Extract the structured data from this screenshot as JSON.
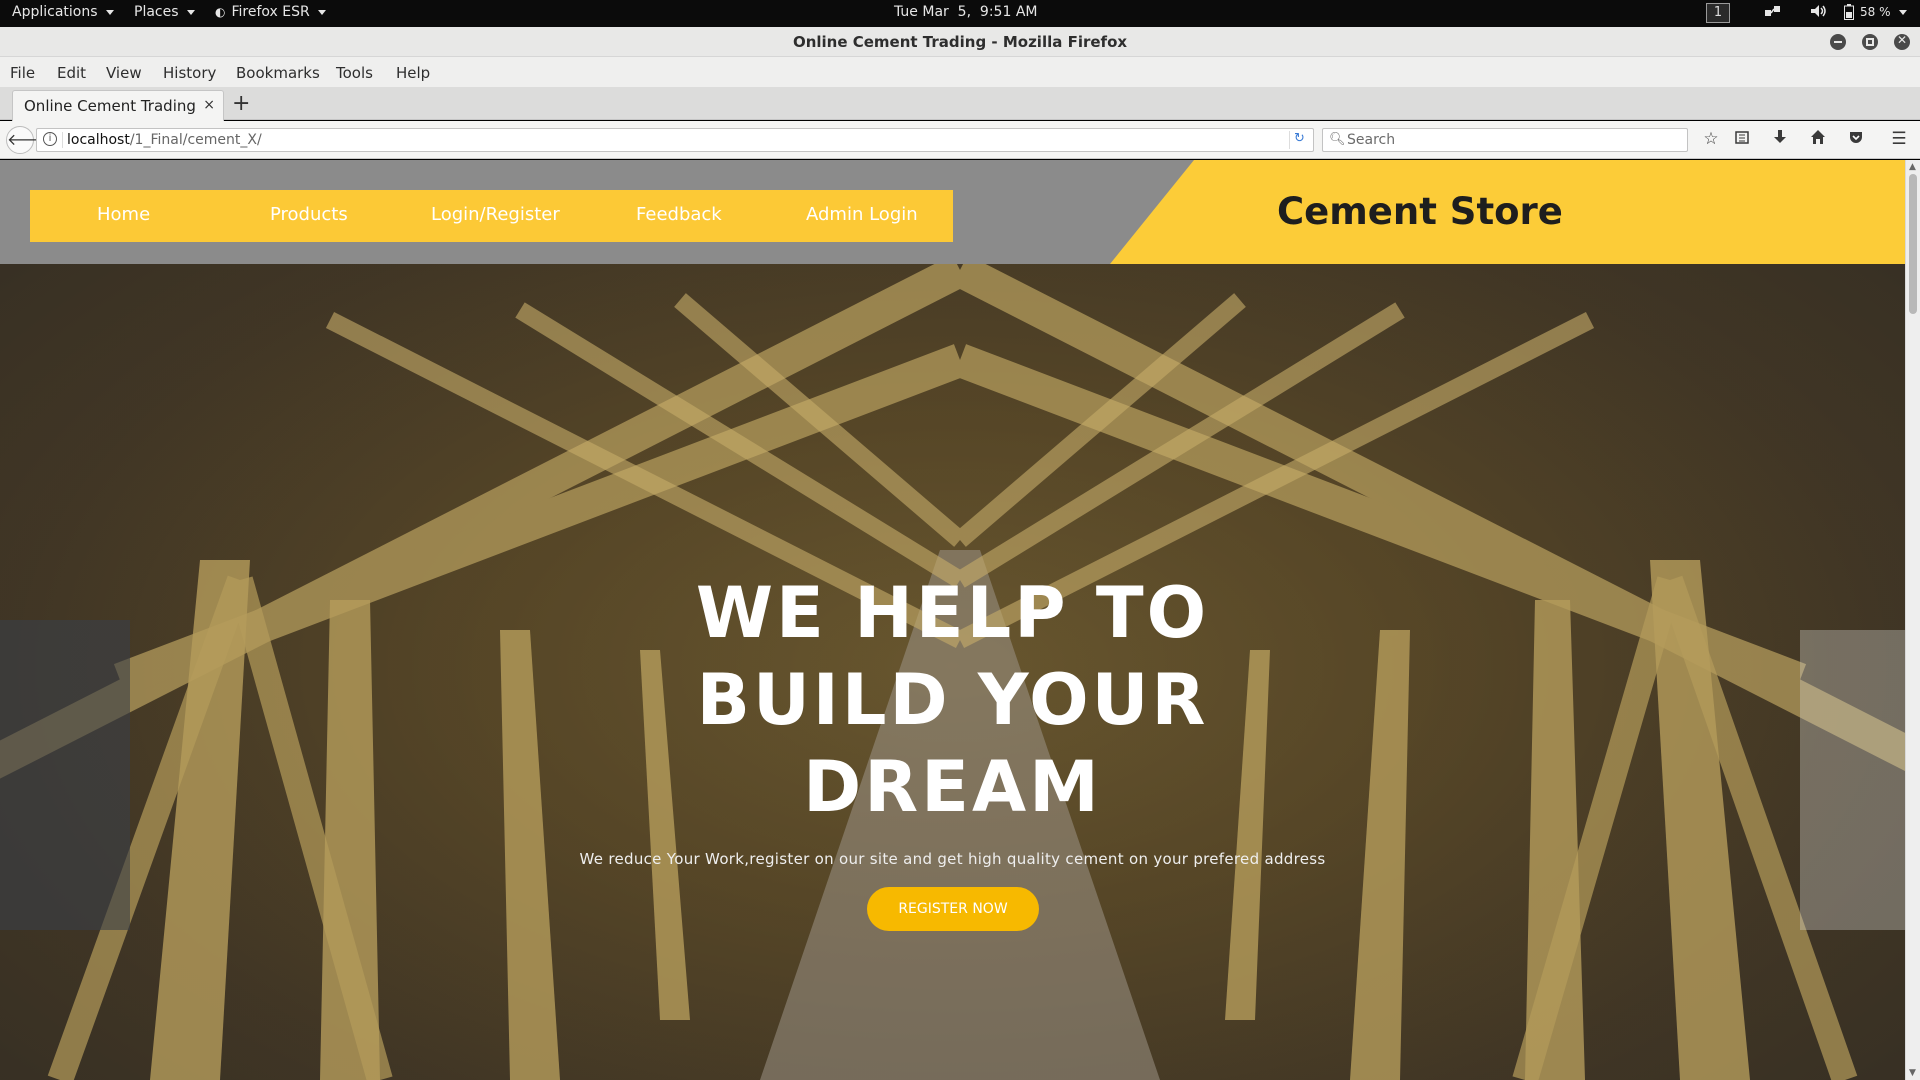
{
  "system_bar": {
    "applications": "Applications",
    "places": "Places",
    "browser": "Firefox ESR",
    "clock": "Tue Mar  5,  9:51 AM",
    "workspace": "1",
    "battery": "58 %"
  },
  "window": {
    "title": "Online Cement Trading - Mozilla Firefox"
  },
  "menu": {
    "file": "File",
    "edit": "Edit",
    "view": "View",
    "history": "History",
    "bookmarks": "Bookmarks",
    "tools": "Tools",
    "help": "Help"
  },
  "tabs": [
    {
      "label": "Online Cement Trading",
      "close": "×"
    }
  ],
  "new_tab": "+",
  "address_bar": {
    "host": "localhost",
    "path": "/1_Final/cement_X/"
  },
  "search": {
    "placeholder": "Search"
  },
  "site": {
    "nav": [
      "Home",
      "Products",
      "Login/Register",
      "Feedback",
      "Admin Login"
    ],
    "brand": "Cement Store",
    "hero_title_lines": [
      "WE HELP TO",
      "BUILD YOUR",
      "DREAM"
    ],
    "hero_subtitle": "We reduce Your Work,register on our site and get high quality cement on your prefered address",
    "cta_label": "REGISTER NOW"
  },
  "colors": {
    "accent_yellow": "#fcc936",
    "cta_orange": "#f7b900",
    "header_gray": "#8b8b8b"
  }
}
